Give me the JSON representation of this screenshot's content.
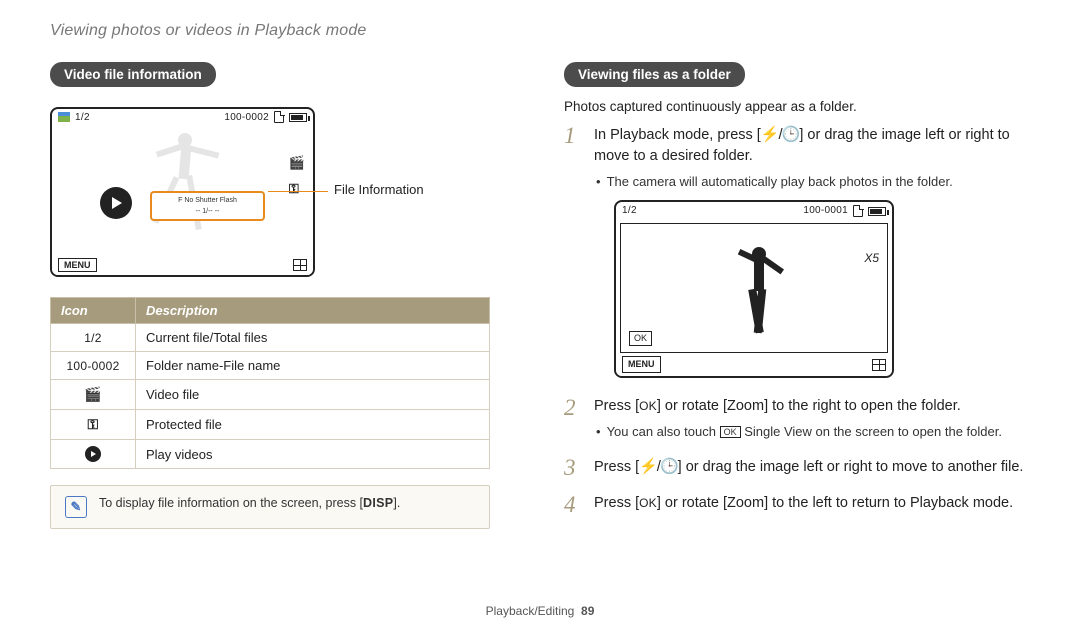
{
  "page_header": "Viewing photos or videos in Playback mode",
  "left": {
    "section_title": "Video file information",
    "screen": {
      "counter": "1/2",
      "folder_file": "100-0002",
      "menu": "MENU",
      "callout": "File Information",
      "info_row_labels": "F No  Shutter  Flash",
      "info_row_vals": "--    1/--    --"
    },
    "table": {
      "head_icon": "Icon",
      "head_desc": "Description",
      "rows": [
        {
          "icon_text": "1/2",
          "desc": "Current file/Total files"
        },
        {
          "icon_text": "100-0002",
          "desc": "Folder name-File name"
        },
        {
          "icon_name": "video",
          "desc": "Video file"
        },
        {
          "icon_name": "key",
          "desc": "Protected file"
        },
        {
          "icon_name": "play",
          "desc": "Play videos"
        }
      ]
    },
    "note": {
      "before": "To display file information on the screen, press [",
      "btn": "DISP",
      "after": "]."
    }
  },
  "right": {
    "section_title": "Viewing files as a folder",
    "intro": "Photos captured continuously appear as a folder.",
    "steps": {
      "s1": {
        "num": "1",
        "pre": "In Playback mode, press [",
        "post": "] or drag the image left or right to move to a desired folder.",
        "sub": "The camera will automatically play back photos in the folder."
      },
      "screen": {
        "counter": "1/2",
        "folder_file": "100-0001",
        "x5": "X5",
        "ok": "OK",
        "menu": "MENU"
      },
      "s2": {
        "num": "2",
        "pre": "Press [",
        "ok": "OK",
        "mid": "] or rotate [",
        "zoom": "Zoom",
        "post": "] to the right to open the folder.",
        "sub_pre": "You can also touch ",
        "sub_ok": "OK",
        "sub_mid": " Single View",
        "sub_post": " on the screen to open the folder."
      },
      "s3": {
        "num": "3",
        "pre": "Press [",
        "post": "] or drag the image left or right to move to another file."
      },
      "s4": {
        "num": "4",
        "pre": "Press [",
        "ok": "OK",
        "mid": "] or rotate [",
        "zoom": "Zoom",
        "post": "] to the left to return to Playback mode."
      }
    }
  },
  "footer": {
    "section": "Playback/Editing",
    "page": "89"
  }
}
